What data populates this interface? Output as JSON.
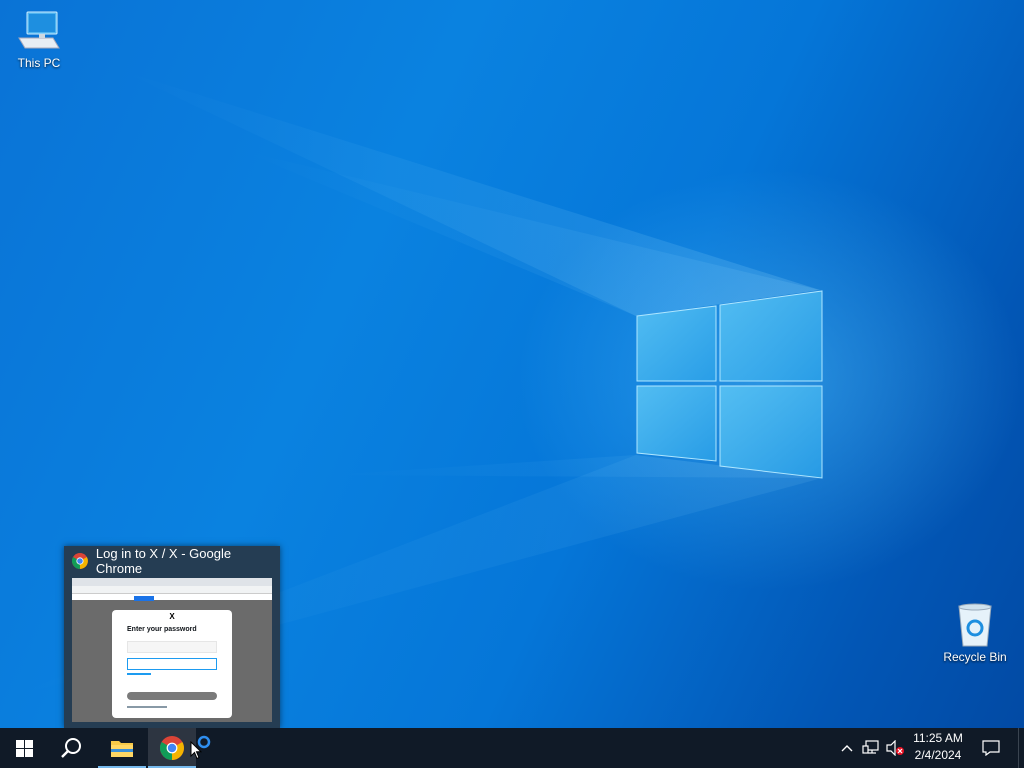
{
  "desktop": {
    "icons": [
      {
        "label": "This PC",
        "icon": "computer-icon"
      },
      {
        "label": "Recycle Bin",
        "icon": "recycle-bin-icon"
      }
    ]
  },
  "preview": {
    "window_title": "Log in to X / X - Google Chrome",
    "icon": "chrome-icon",
    "thumbnail": {
      "logo": "X",
      "heading": "Enter your password"
    }
  },
  "taskbar": {
    "start": "windows-logo-icon",
    "search": "search-icon",
    "pinned": [
      {
        "name": "File Explorer",
        "icon": "folder-icon"
      },
      {
        "name": "Google Chrome",
        "icon": "chrome-icon",
        "active": true
      }
    ],
    "tray": {
      "show_hidden": "chevron-up-icon",
      "network": "network-icon",
      "volume": "volume-muted-icon",
      "time": "11:25 AM",
      "date": "2/4/2024",
      "notifications": "notification-icon"
    }
  },
  "colors": {
    "taskbar": "#101a27",
    "accent": "#76b9ed",
    "wallpaper": "#0078d7"
  }
}
